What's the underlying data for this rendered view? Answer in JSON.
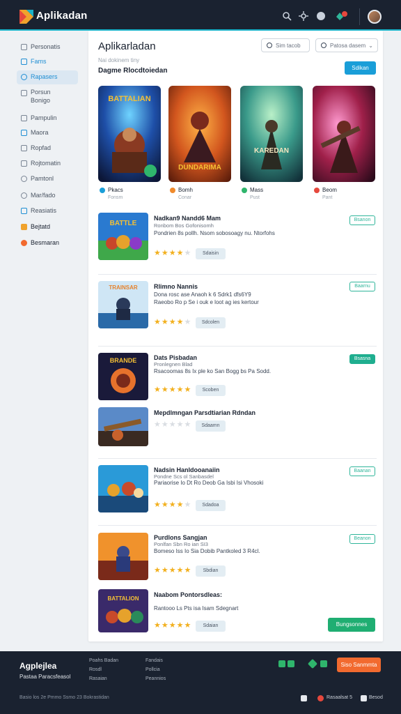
{
  "header": {
    "brand": "Aplikadan",
    "icons": [
      "search-icon",
      "settings-icon",
      "circle-icon",
      "notification-icon"
    ]
  },
  "sidebar": {
    "items": [
      {
        "label": "Personatis",
        "icon": "doc-icon"
      },
      {
        "label": "Fams",
        "icon": "list-icon"
      },
      {
        "label": "Rapasers",
        "icon": "search-icon"
      },
      {
        "label": "Porsun Bonigo",
        "icon": "user-icon"
      },
      {
        "label": "Pampulin",
        "icon": "link-icon"
      },
      {
        "label": "Maora",
        "icon": "grid-icon"
      },
      {
        "label": "Ropfad",
        "icon": "tag-icon"
      },
      {
        "label": "Rojtomatin",
        "icon": "chart-icon"
      },
      {
        "label": "Pamtonl",
        "icon": "chat-icon"
      },
      {
        "label": "Mar/fado",
        "icon": "mail-icon"
      },
      {
        "label": "Reasiatis",
        "icon": "star-icon"
      },
      {
        "label": "Bejtatd",
        "icon": "trophy-icon"
      },
      {
        "label": "Besmaran",
        "icon": "fire-icon"
      }
    ]
  },
  "main": {
    "title": "Aplikarladan",
    "subtitle": "Nai dokinem tiny",
    "section_title": "Dagme Rlocdtoiedan",
    "search_placeholder": "Sim tacob",
    "select_value": "Patosa dasem",
    "action_label": "Sdikan"
  },
  "featured": [
    {
      "name": "Pkacs",
      "meta": "Fonsm",
      "dot_color": "#1a9ed8"
    },
    {
      "name": "Bomh",
      "meta": "Conar",
      "dot_color": "#f08a2c"
    },
    {
      "name": "Mass",
      "meta": "Pust",
      "dot_color": "#2fb56c"
    },
    {
      "name": "Beom",
      "meta": "Pant",
      "dot_color": "#e6483d"
    }
  ],
  "featured_art_titles": [
    "BATTALIAN",
    "DUNDARIMA",
    "KAREDAN",
    ""
  ],
  "list": [
    {
      "title": "Nadkan9 Nandd6 Mam",
      "sub": "Ronbom Bos Gofonisomh",
      "desc": [
        "Pondrien 8s pollh. Nsom sobosoagy nu. Ntorfohs"
      ],
      "stars": 4,
      "pill": "Sdaisin",
      "action": "Bsanon",
      "art": "BATTLE"
    },
    {
      "title": "Rlimno Nannis",
      "sub": "",
      "desc": [
        "Dona rosc ase Anaoh k 6 Sdrk1 dfs6Y9",
        "Raeobo Ro p Se i ouk e loot ag ies kertour"
      ],
      "stars": 4,
      "pill": "Sdcolen",
      "action": "Baarnu",
      "art": "TRAINSAR"
    },
    {
      "title": "Dats Pisbadan",
      "sub": "Pronlegnen Blad",
      "desc": [
        "Rsacoomas 8s Ix ple ko San Bogg bs Pa Sodd."
      ],
      "stars": 5,
      "pill": "Scoben",
      "action": "Bsasna",
      "filled": true,
      "art": "BRANDE"
    },
    {
      "title": "Mepdlmngan Parsdtiarian Rdndan",
      "sub": "",
      "desc": [],
      "stars": 0,
      "pill": "Sdaamn",
      "action": "",
      "art": ""
    },
    {
      "title": "Nadsin Hanldooanaiin",
      "sub": "Pondne Scs ol Sanbasdel",
      "desc": [
        "Pariaorise Io Dt Ro Deob Ga Isbi Isi Vhosoki"
      ],
      "stars": 4,
      "pill": "Sdadoa",
      "action": "Baanan",
      "art": ""
    },
    {
      "title": "Purdlons Sangjan",
      "sub": "Ponlfan Sbn Ro ian SI3",
      "desc": [
        "Bomeso Iss Io Sia Dobib Pantkoled 3 R4cl."
      ],
      "stars": 5,
      "pill": "Sbdian",
      "action": "Beanon",
      "art": ""
    },
    {
      "title": "Naabom Pontorsdleas:",
      "sub": "",
      "desc": [
        "Rantooo Ls Pts isa Isam Sdegnart"
      ],
      "stars": 5,
      "pill": "Sdaian",
      "action": "Bungsonnes",
      "art": "BATTALION"
    }
  ],
  "footer": {
    "brand": "Agplejlea",
    "tagline": "Pastaa Paracsfeasol",
    "col1": [
      "Poahs Badan",
      "Rosdl",
      "Rasaian"
    ],
    "col2": [
      "Fandais",
      "Pollcia",
      "Peannios"
    ],
    "cta": "Siso Sanmmta",
    "copyright": "Basio los 2e Pmmo Ssmo 23 Bokrastidan",
    "bottom_links": [
      "Rasaalsat 5",
      "Besod"
    ]
  },
  "colors": {
    "accent": "#19b3c9",
    "primary": "#1a9ed8",
    "success": "#1fae8f",
    "cta": "#f26a2f",
    "star": "#f2b01e",
    "nav_bg": "#1a2230"
  }
}
